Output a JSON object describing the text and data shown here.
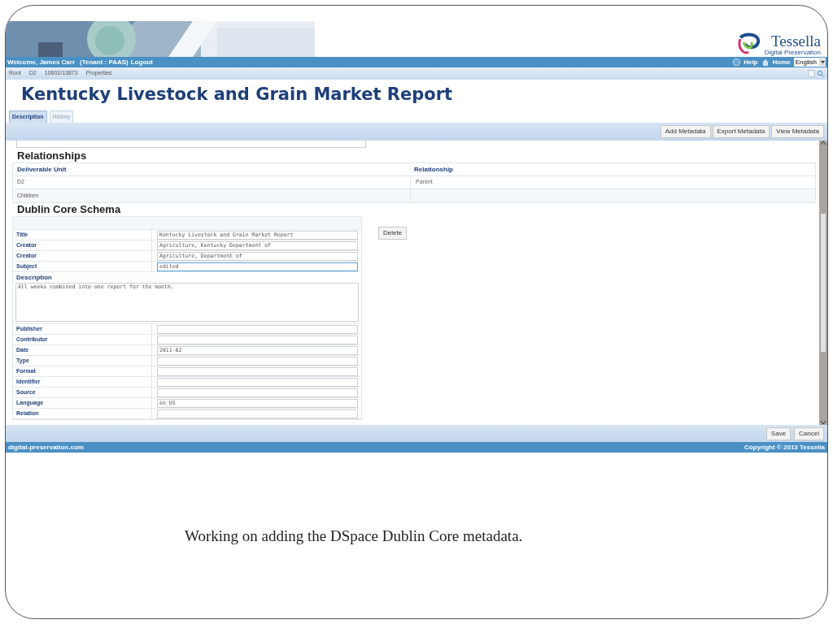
{
  "header": {
    "logo": {
      "name": "Tessella",
      "tagline": "Digital Preservation"
    },
    "welcome": "Welcome, James Carr",
    "tenant": "(Tenant : PAAS)",
    "logout": "Logout",
    "help": "Help",
    "home": "Home",
    "language": "English"
  },
  "breadcrumb": [
    "Root",
    "D2",
    "10602/13873",
    "Properties"
  ],
  "title": "Kentucky Livestock and Grain Market Report",
  "tabs": [
    {
      "label": "Description",
      "selected": true
    },
    {
      "label": "History",
      "selected": false
    }
  ],
  "toolbar_buttons": [
    "Add Metadata",
    "Export Metadata",
    "View Metadata"
  ],
  "relationships": {
    "heading": "Relationships",
    "columns": [
      "Deliverable Unit",
      "Relationship"
    ],
    "rows": [
      [
        "D2",
        "Parent"
      ],
      [
        "Children",
        ""
      ]
    ]
  },
  "dublin_core": {
    "heading": "Dublin Core Schema",
    "delete": "Delete",
    "fields": [
      {
        "kind": "line",
        "label": "Title",
        "value": "Kentucky Livestock and Grain Market Report",
        "focused": false
      },
      {
        "kind": "line",
        "label": "Creator",
        "value": "Agriculture, Kentucky Department of",
        "focused": false
      },
      {
        "kind": "line",
        "label": "Creator",
        "value": "Agriculture, Department of",
        "focused": false
      },
      {
        "kind": "line",
        "label": "Subject",
        "value": "edited",
        "focused": true
      },
      {
        "kind": "area",
        "label": "Description",
        "value": "All weeks combined into one report for the month.",
        "focused": false
      },
      {
        "kind": "line",
        "label": "Publisher",
        "focused": false
      },
      {
        "kind": "line",
        "label": "Contributor",
        "focused": false
      },
      {
        "kind": "line",
        "label": "Date",
        "value": "2011-02",
        "focused": false
      },
      {
        "kind": "line",
        "label": "Type",
        "focused": false
      },
      {
        "kind": "line",
        "label": "Format",
        "focused": false
      },
      {
        "kind": "line",
        "label": "Identifier",
        "focused": false
      },
      {
        "kind": "line",
        "label": "Source",
        "focused": false
      },
      {
        "kind": "line",
        "label": "Language",
        "value": "en_US",
        "focused": false
      },
      {
        "kind": "line",
        "label": "Relation",
        "focused": false
      }
    ]
  },
  "bottom_buttons": [
    "Save",
    "Cancel"
  ],
  "footer": {
    "left": "digital-preservation.com",
    "right": "Copyright © 2013 Tessella"
  },
  "caption": "Working on adding the DSpace Dublin Core metadata."
}
